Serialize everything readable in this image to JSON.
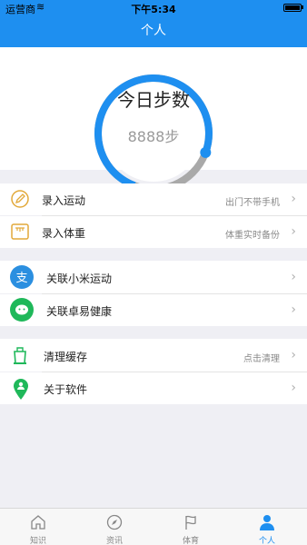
{
  "status_bar": {
    "carrier": "运营商",
    "time": "下午5:34"
  },
  "nav": {
    "title": "个人"
  },
  "summary": {
    "title": "今日步数",
    "steps": "8888步",
    "ring_progress": 0.75
  },
  "sections": {
    "record": [
      {
        "label": "录入运动",
        "hint": "出门不带手机"
      },
      {
        "label": "录入体重",
        "hint": "体重实时备份"
      }
    ],
    "link": [
      {
        "label": "关联小米运动"
      },
      {
        "label": "关联卓易健康"
      }
    ],
    "misc": [
      {
        "label": "清理缓存",
        "hint": "点击清理"
      },
      {
        "label": "关于软件"
      }
    ]
  },
  "tabs": [
    {
      "label": "知识"
    },
    {
      "label": "资讯"
    },
    {
      "label": "体育"
    },
    {
      "label": "个人"
    }
  ],
  "colors": {
    "accent": "#1e8ff0",
    "ring_track": "#a9a9a9"
  }
}
